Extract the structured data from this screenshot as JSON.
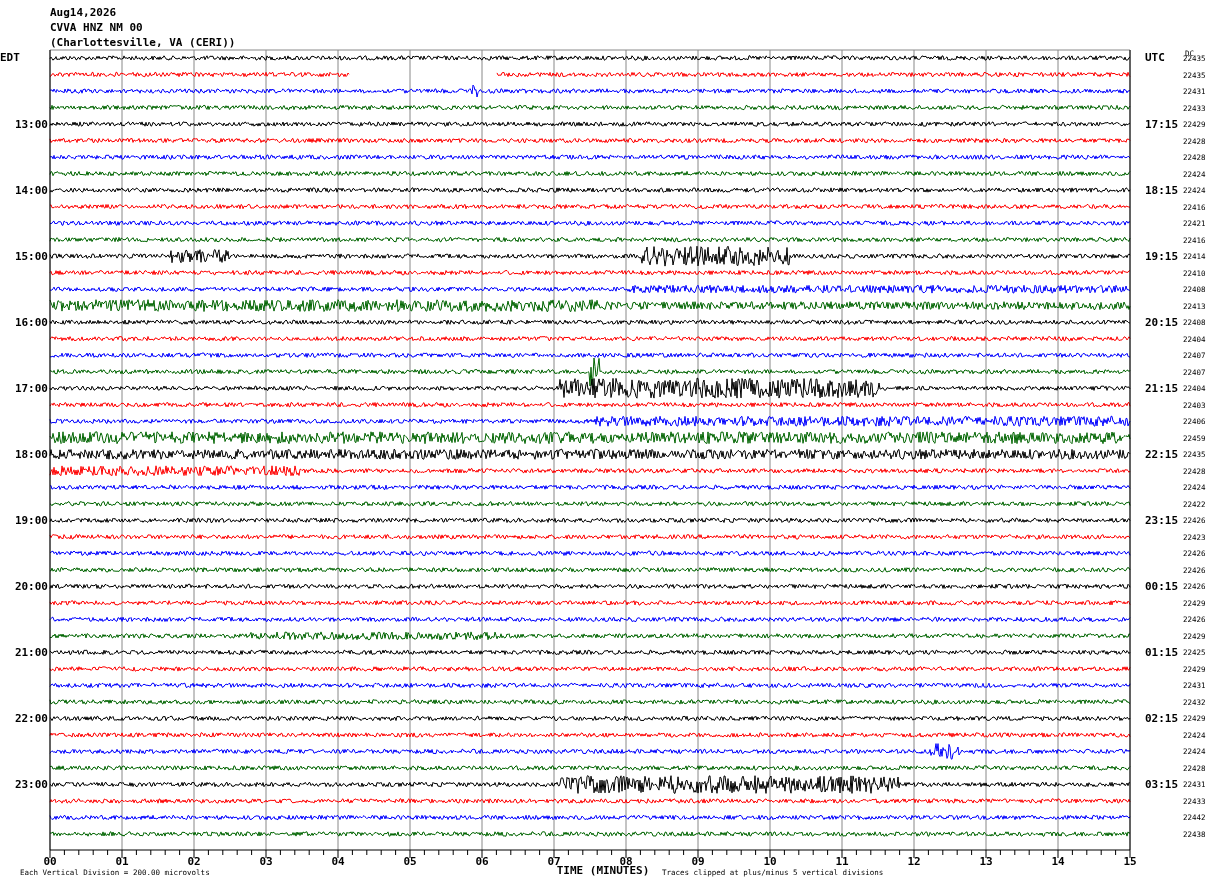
{
  "header": {
    "date": "Aug14,2026",
    "station": "CVVA HNZ NM 00",
    "location": "(Charlottesville, VA (CERI))"
  },
  "left_zone": "EDT",
  "right_zone": "UTC",
  "dc_header": "DC",
  "traces": [
    {
      "color": "#000000",
      "dc": "22435"
    },
    {
      "color": "#ff0000",
      "dc": "22435"
    },
    {
      "color": "#0000ff",
      "dc": "22431"
    },
    {
      "color": "#006400",
      "dc": "22433"
    },
    {
      "color": "#000000",
      "dc": "22429",
      "left_time": "13:00",
      "right_time": "17:15"
    },
    {
      "color": "#ff0000",
      "dc": "22428"
    },
    {
      "color": "#0000ff",
      "dc": "22428"
    },
    {
      "color": "#006400",
      "dc": "22424"
    },
    {
      "color": "#000000",
      "dc": "22424",
      "left_time": "14:00",
      "right_time": "18:15"
    },
    {
      "color": "#ff0000",
      "dc": "22416"
    },
    {
      "color": "#0000ff",
      "dc": "22421"
    },
    {
      "color": "#006400",
      "dc": "22416"
    },
    {
      "color": "#000000",
      "dc": "22414",
      "left_time": "15:00",
      "right_time": "19:15"
    },
    {
      "color": "#ff0000",
      "dc": "22410"
    },
    {
      "color": "#0000ff",
      "dc": "22408"
    },
    {
      "color": "#006400",
      "dc": "22413"
    },
    {
      "color": "#000000",
      "dc": "22408",
      "left_time": "16:00",
      "right_time": "20:15"
    },
    {
      "color": "#ff0000",
      "dc": "22404"
    },
    {
      "color": "#0000ff",
      "dc": "22407"
    },
    {
      "color": "#006400",
      "dc": "22407"
    },
    {
      "color": "#000000",
      "dc": "22404",
      "left_time": "17:00",
      "right_time": "21:15"
    },
    {
      "color": "#ff0000",
      "dc": "22403"
    },
    {
      "color": "#0000ff",
      "dc": "22406"
    },
    {
      "color": "#006400",
      "dc": "22459"
    },
    {
      "color": "#000000",
      "dc": "22435",
      "left_time": "18:00",
      "right_time": "22:15"
    },
    {
      "color": "#ff0000",
      "dc": "22428"
    },
    {
      "color": "#0000ff",
      "dc": "22424"
    },
    {
      "color": "#006400",
      "dc": "22422"
    },
    {
      "color": "#000000",
      "dc": "22426",
      "left_time": "19:00",
      "right_time": "23:15"
    },
    {
      "color": "#ff0000",
      "dc": "22423"
    },
    {
      "color": "#0000ff",
      "dc": "22426"
    },
    {
      "color": "#006400",
      "dc": "22426"
    },
    {
      "color": "#000000",
      "dc": "22426",
      "left_time": "20:00",
      "right_time": "00:15"
    },
    {
      "color": "#ff0000",
      "dc": "22429"
    },
    {
      "color": "#0000ff",
      "dc": "22426"
    },
    {
      "color": "#006400",
      "dc": "22429"
    },
    {
      "color": "#000000",
      "dc": "22425",
      "left_time": "21:00",
      "right_time": "01:15"
    },
    {
      "color": "#ff0000",
      "dc": "22429"
    },
    {
      "color": "#0000ff",
      "dc": "22431"
    },
    {
      "color": "#006400",
      "dc": "22432"
    },
    {
      "color": "#000000",
      "dc": "22429",
      "left_time": "22:00",
      "right_time": "02:15"
    },
    {
      "color": "#ff0000",
      "dc": "22424"
    },
    {
      "color": "#0000ff",
      "dc": "22424"
    },
    {
      "color": "#006400",
      "dc": "22428"
    },
    {
      "color": "#000000",
      "dc": "22431",
      "left_time": "23:00",
      "right_time": "03:15"
    },
    {
      "color": "#ff0000",
      "dc": "22433"
    },
    {
      "color": "#0000ff",
      "dc": "22442"
    },
    {
      "color": "#006400",
      "dc": "22438"
    }
  ],
  "time_axis": {
    "ticks": [
      "00",
      "01",
      "02",
      "03",
      "04",
      "05",
      "06",
      "07",
      "08",
      "09",
      "10",
      "11",
      "12",
      "13",
      "14",
      "15"
    ],
    "title": "TIME (MINUTES)"
  },
  "scale_note": "Each Vertical Division =  200.00 microvolts",
  "clip_note": "Traces clipped at plus/minus 5 vertical divisions"
}
